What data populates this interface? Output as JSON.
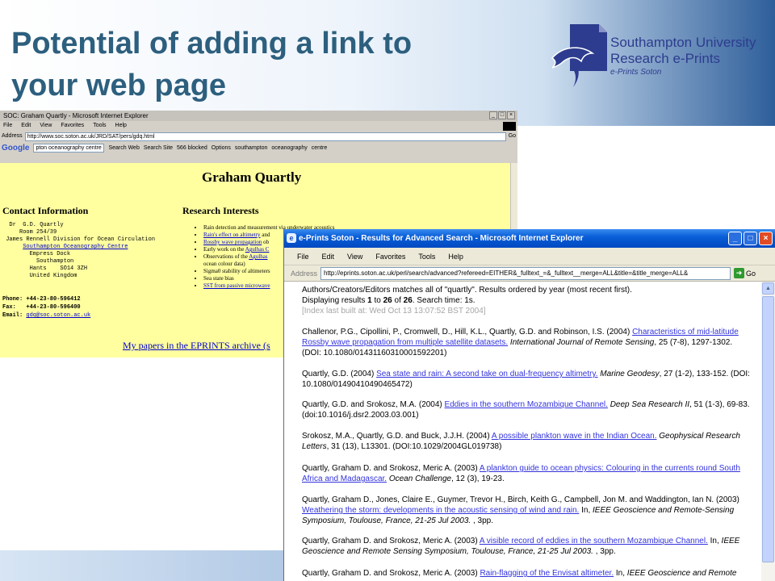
{
  "slide": {
    "title_line1": "Potential of adding a link to",
    "title_line2": "your web page",
    "logo": {
      "line1": "Southampton University",
      "line2": "Research e-Prints",
      "line3": "e-Prints Soton"
    }
  },
  "window1": {
    "title": "SOC: Graham Quartly - Microsoft Internet Explorer",
    "menu": [
      "File",
      "Edit",
      "View",
      "Favorites",
      "Tools",
      "Help"
    ],
    "address_label": "Address",
    "address_value": "http://www.soc.soton.ac.uk/JRD/SAT/pers/gdq.html",
    "go_label": "Go",
    "google": {
      "logo": "Google",
      "query": "pton oceanography centre",
      "buttons": [
        "Search Web",
        "Search Site",
        "566 blocked",
        "Options",
        "southampton",
        "oceanography",
        "centre"
      ]
    },
    "page": {
      "name": "Graham Quartly",
      "contact_heading": "Contact Information",
      "contact_lines": [
        "  Dr  G.D. Quartly",
        "     Room 254/39",
        " James Rennell Division for Ocean Circulation"
      ],
      "contact_link": "Southampton Oceanography Centre",
      "contact_lines2": [
        "        Empress Dock",
        "          Southampton",
        "        Hants    SO14 3ZH",
        "        United Kingdom"
      ],
      "phone": "Phone: +44-23-80-596412",
      "fax": "Fax:   +44-23-80-596400",
      "email_label": "Email: ",
      "email": "gdq@soc.soton.ac.uk",
      "research_heading": "Research Interests",
      "research_items": [
        {
          "text": "Rain detection and measurement via underwater acoustics",
          "link": false
        },
        {
          "text": "Rain's effect on altimetry",
          "link": true,
          "suffix": " and"
        },
        {
          "text": "Rossby wave propagation",
          "link": true,
          "suffix": " ob"
        },
        {
          "text": "Early work on the ",
          "link": false,
          "linkText": "Agulhas C"
        },
        {
          "text": "Observations of the ",
          "link": false,
          "linkText": "Agulhas"
        },
        {
          "text": "ocean colour data)",
          "link": false,
          "indent": true
        },
        {
          "text": "Sigma0 stability of altimeters",
          "link": false
        },
        {
          "text": "Sea state bias",
          "link": false
        },
        {
          "text": "SST from passive microwave",
          "link": true
        }
      ],
      "papers_link": "My papers in the EPRINTS archive (s"
    }
  },
  "window2": {
    "title": "e-Prints Soton - Results for Advanced Search - Microsoft Internet Explorer",
    "menu": [
      "File",
      "Edit",
      "View",
      "Favorites",
      "Tools",
      "Help"
    ],
    "address_label": "Address",
    "address_value": "http://eprints.soton.ac.uk/perl/search/advanced?refereed=EITHER&_fulltext_=&_fulltext__merge=ALL&title=&title_merge=ALL&",
    "go_label": "Go",
    "header_line1": "Authors/Creators/Editors matches all of \"quartly\". Results ordered by year (most recent first).",
    "header_line2_pre": "Displaying results ",
    "header_from": "1",
    "header_to_pre": " to ",
    "header_to": "26",
    "header_of_pre": " of ",
    "header_total": "26",
    "header_line2_post": ". Search time: 1s.",
    "header_line3": "[Index last built at: Wed Oct 13 13:07:52 BST 2004]",
    "entries": [
      {
        "authors": "Challenor, P.G., Cipollini, P., Cromwell, D., Hill, K.L., Quartly, G.D. and Robinson, I.S. (2004) ",
        "link": "Characteristics of mid-latitude Rossby wave propagation from multiple satellite datasets.",
        "journal": "International Journal of Remote Sensing",
        "rest": ", 25 (7-8), 1297-1302. (DOI: 10.1080/01431160310001592201)"
      },
      {
        "authors": "Quartly, G.D. (2004) ",
        "link": "Sea state and rain: A second take on dual-frequency altimetry.",
        "journal": "Marine Geodesy",
        "rest": ", 27 (1-2), 133-152. (DOI: 10.1080/01490410490465472)"
      },
      {
        "authors": "Quartly, G.D. and Srokosz, M.A. (2004) ",
        "link": "Eddies in the southern Mozambique Channel.",
        "journal": "Deep Sea Research II",
        "rest": ", 51 (1-3), 69-83. (doi:10.1016/j.dsr2.2003.03.001)"
      },
      {
        "authors": "Srokosz, M.A., Quartly, G.D. and Buck, J.J.H. (2004) ",
        "link": "A possible plankton wave in the Indian Ocean.",
        "journal": "Geophysical Research Letters",
        "rest": ", 31 (13), L13301. (DOI:10.1029/2004GL019738)"
      },
      {
        "authors": "Quartly, Graham D. and Srokosz, Meric A. (2003) ",
        "link": "A plankton guide to ocean physics: Colouring in the currents round South Africa and Madagascar.",
        "journal": "Ocean Challenge",
        "rest": ", 12 (3), 19-23."
      },
      {
        "authors": "Quartly, Graham D., Jones, Claire E., Guymer, Trevor H., Birch, Keith G., Campbell, Jon M. and Waddington, Ian N. (2003) ",
        "link": "Weathering the storm: developments in the acoustic sensing of wind and rain.",
        "pre_journal": " In, ",
        "journal": "IEEE Geoscience and Remote-Sensing Symposium, Toulouse, France, 21-25 Jul 2003.",
        "rest": " , 3pp."
      },
      {
        "authors": "Quartly, Graham D. and Srokosz, Meric A. (2003) ",
        "link": "A visible record of eddies in the southern Mozambique Channel.",
        "pre_journal": " In, ",
        "journal": "IEEE Geoscience and Remote Sensing Symposium, Toulouse, France, 21-25 Jul 2003.",
        "rest": " , 3pp."
      },
      {
        "authors": "Quartly, Graham D. and Srokosz, Meric A. (2003) ",
        "link": "Rain-flagging of the Envisat altimeter.",
        "pre_journal": " In, ",
        "journal": "IEEE Geoscience and Remote",
        "rest": ""
      }
    ]
  }
}
